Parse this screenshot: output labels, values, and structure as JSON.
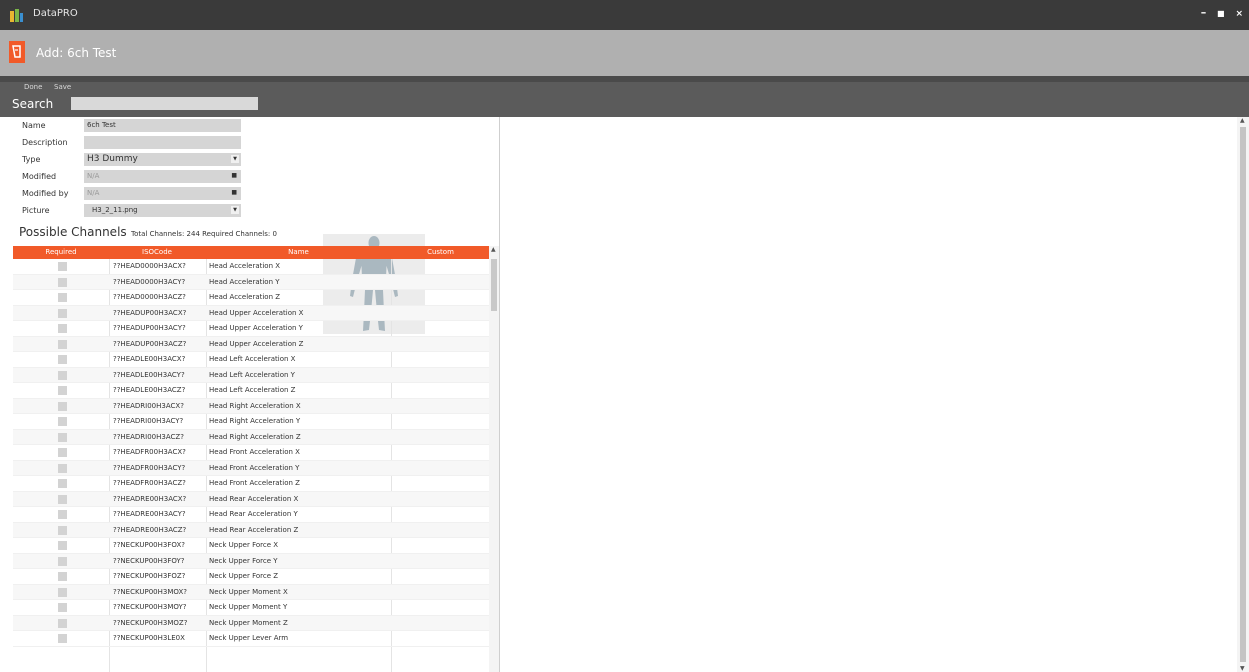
{
  "window": {
    "title": "DataPRO",
    "controls": [
      "–",
      "■",
      "×"
    ]
  },
  "header": {
    "title": "Add: 6ch Test",
    "icon": "add-dummy-icon"
  },
  "toolbar": {
    "done_label": "Done",
    "save_label": "Save"
  },
  "search": {
    "label": "Search",
    "value": ""
  },
  "form": {
    "name_label": "Name",
    "name_value": "6ch Test",
    "description_label": "Description",
    "description_value": "",
    "type_label": "Type",
    "type_value": "H3 Dummy",
    "modified_label": "Modified",
    "modified_value": "N/A",
    "modified_by_label": "Modified by",
    "modified_by_value": "N/A",
    "picture_label": "Picture",
    "picture_value": "H3_2_11.png"
  },
  "channels": {
    "title": "Possible Channels",
    "stats": "Total Channels: 244 Required Channels: 0",
    "columns": {
      "required": "Required",
      "isocode": "ISOCode",
      "name": "Name",
      "custom": "Custom"
    },
    "rows": [
      {
        "iso": "??HEAD0000H3ACX?",
        "name": "Head Acceleration X"
      },
      {
        "iso": "??HEAD0000H3ACY?",
        "name": "Head Acceleration Y"
      },
      {
        "iso": "??HEAD0000H3ACZ?",
        "name": "Head Acceleration Z"
      },
      {
        "iso": "??HEADUP00H3ACX?",
        "name": "Head Upper Acceleration X"
      },
      {
        "iso": "??HEADUP00H3ACY?",
        "name": "Head Upper Acceleration Y"
      },
      {
        "iso": "??HEADUP00H3ACZ?",
        "name": "Head Upper Acceleration Z"
      },
      {
        "iso": "??HEADLE00H3ACX?",
        "name": "Head Left Acceleration X"
      },
      {
        "iso": "??HEADLE00H3ACY?",
        "name": "Head Left Acceleration Y"
      },
      {
        "iso": "??HEADLE00H3ACZ?",
        "name": "Head Left Acceleration Z"
      },
      {
        "iso": "??HEADRI00H3ACX?",
        "name": "Head Right Acceleration X"
      },
      {
        "iso": "??HEADRI00H3ACY?",
        "name": "Head Right Acceleration Y"
      },
      {
        "iso": "??HEADRI00H3ACZ?",
        "name": "Head Right Acceleration Z"
      },
      {
        "iso": "??HEADFR00H3ACX?",
        "name": "Head Front Acceleration X"
      },
      {
        "iso": "??HEADFR00H3ACY?",
        "name": "Head Front Acceleration Y"
      },
      {
        "iso": "??HEADFR00H3ACZ?",
        "name": "Head Front Acceleration Z"
      },
      {
        "iso": "??HEADRE00H3ACX?",
        "name": "Head Rear Acceleration X"
      },
      {
        "iso": "??HEADRE00H3ACY?",
        "name": "Head Rear Acceleration Y"
      },
      {
        "iso": "??HEADRE00H3ACZ?",
        "name": "Head Rear Acceleration Z"
      },
      {
        "iso": "??NECKUP00H3FOX?",
        "name": "Neck Upper Force X"
      },
      {
        "iso": "??NECKUP00H3FOY?",
        "name": "Neck Upper Force Y"
      },
      {
        "iso": "??NECKUP00H3FOZ?",
        "name": "Neck Upper Force Z"
      },
      {
        "iso": "??NECKUP00H3MOX?",
        "name": "Neck Upper Moment X"
      },
      {
        "iso": "??NECKUP00H3MOY?",
        "name": "Neck Upper Moment Y"
      },
      {
        "iso": "??NECKUP00H3MOZ?",
        "name": "Neck Upper Moment Z"
      },
      {
        "iso": "??NECKUP00H3LE0X",
        "name": "Neck Upper Lever Arm"
      }
    ]
  },
  "colors": {
    "accent": "#f15a29",
    "titlebar": "#3a3a3a",
    "header": "#b0b0b0",
    "toolbar": "#5b5b5b"
  }
}
